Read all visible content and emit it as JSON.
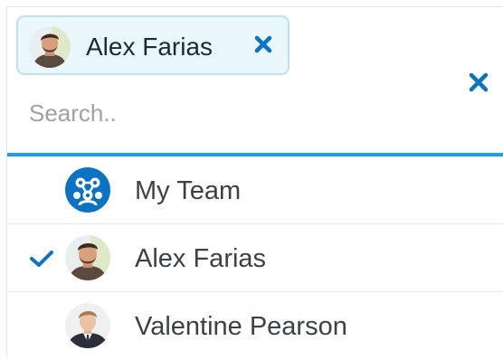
{
  "selected_chip": {
    "label": "Alex Farias",
    "remove_icon": "close-icon"
  },
  "clear_all_icon": "close-icon",
  "search": {
    "placeholder": "Search..",
    "value": ""
  },
  "options": [
    {
      "label": "My Team",
      "avatar": "team-icon",
      "selected": false
    },
    {
      "label": "Alex Farias",
      "avatar": "user-avatar",
      "selected": true
    },
    {
      "label": "Valentine Pearson",
      "avatar": "user-avatar",
      "selected": false
    }
  ],
  "colors": {
    "accent": "#1a9fe0",
    "icon_blue": "#0b73c5",
    "chip_bg": "#eaf7fd",
    "chip_border": "#b9e2f6"
  }
}
